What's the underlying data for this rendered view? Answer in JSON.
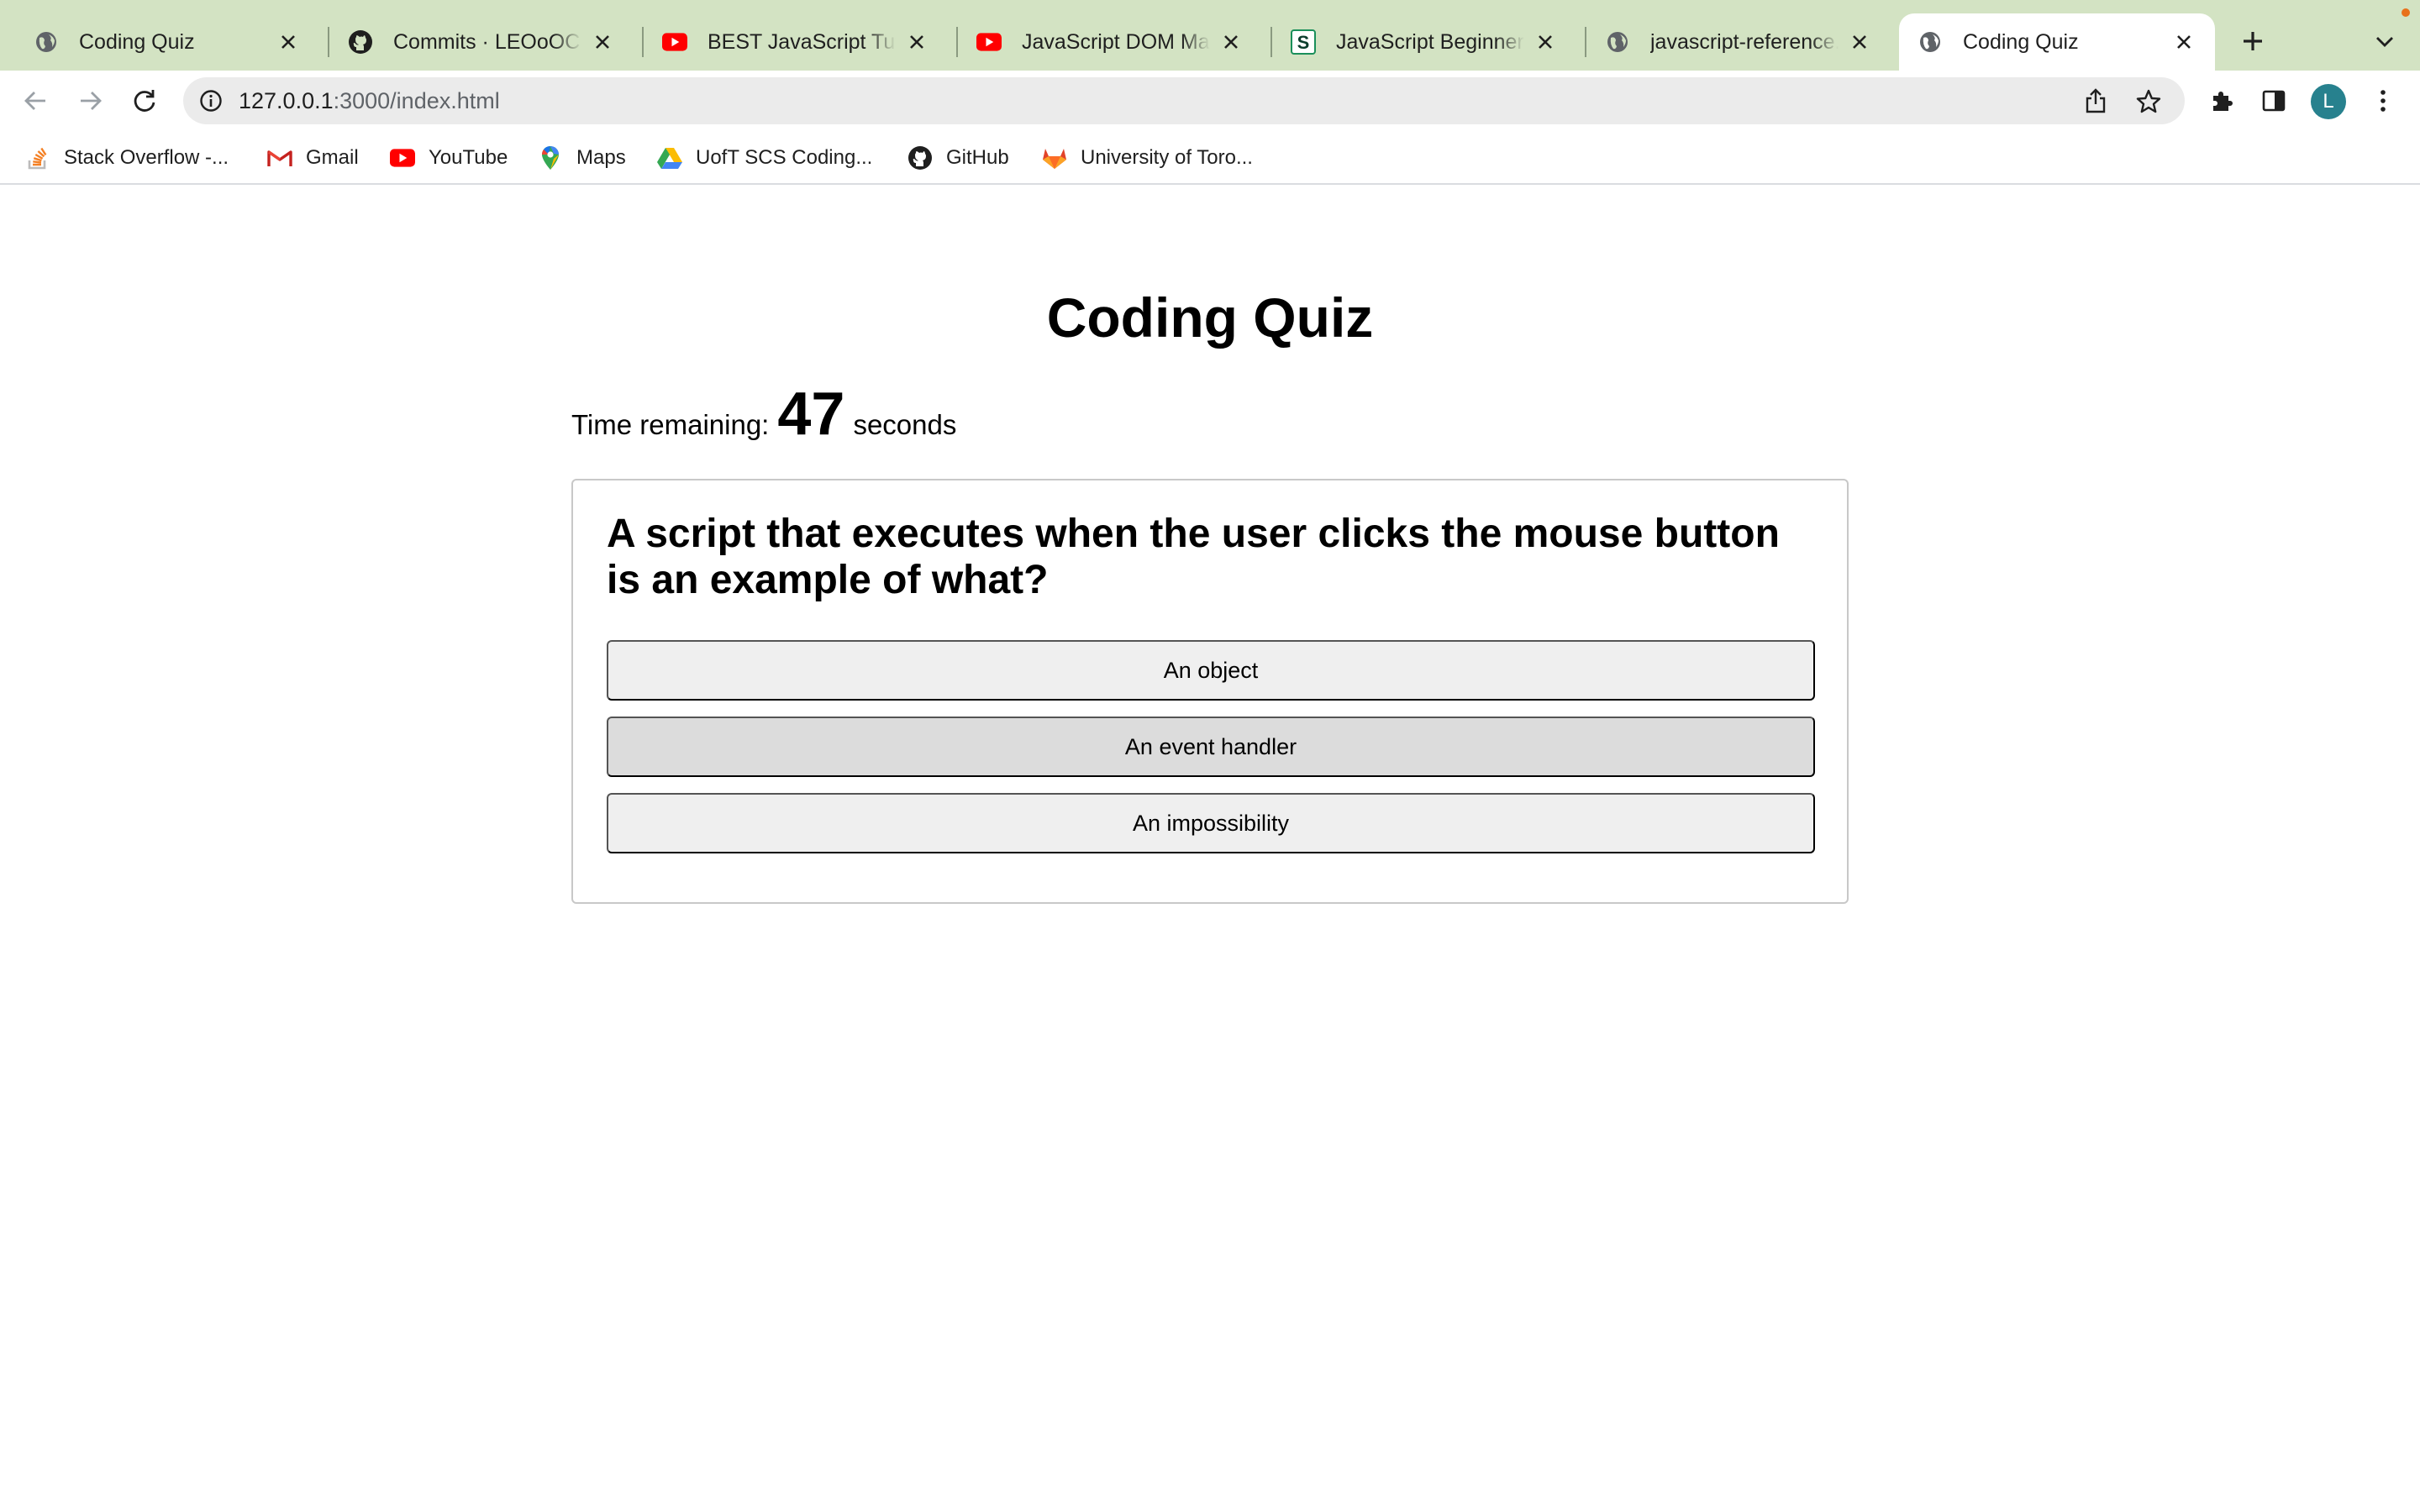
{
  "browser": {
    "tabs": [
      {
        "title": "Coding Quiz",
        "icon": "globe-icon",
        "active": false
      },
      {
        "title": "Commits · LEOoOChan",
        "icon": "github-icon",
        "active": false
      },
      {
        "title": "BEST JavaScript Tutorial",
        "icon": "youtube-icon",
        "active": false
      },
      {
        "title": "JavaScript DOM Manipulation",
        "icon": "youtube-icon",
        "active": false
      },
      {
        "title": "JavaScript Beginner Cheatsheet",
        "icon": "s-logo-icon",
        "active": false
      },
      {
        "title": "javascript-reference.pdf",
        "icon": "globe-icon",
        "active": false
      },
      {
        "title": "Coding Quiz",
        "icon": "globe-icon",
        "active": true
      }
    ],
    "address_bar": {
      "host": "127.0.0.1",
      "path": ":3000/index.html"
    },
    "profile_initial": "L",
    "bookmarks": [
      {
        "label": "Stack Overflow -...",
        "icon": "stackoverflow-icon"
      },
      {
        "label": "Gmail",
        "icon": "gmail-icon"
      },
      {
        "label": "YouTube",
        "icon": "youtube-icon"
      },
      {
        "label": "Maps",
        "icon": "maps-pin-icon"
      },
      {
        "label": "UofT SCS Coding...",
        "icon": "google-drive-icon"
      },
      {
        "label": "GitHub",
        "icon": "github-icon"
      },
      {
        "label": "University of Toro...",
        "icon": "gitlab-icon"
      }
    ],
    "colors": {
      "tabstrip": "#d3e3c3",
      "youtube_red": "#ff0000",
      "avatar": "#27818e"
    }
  },
  "page": {
    "title": "Coding Quiz",
    "timer": {
      "label": "Time remaining:",
      "value": "47",
      "unit": "seconds"
    },
    "question": "A script that executes when the user clicks the mouse button is an example of what?",
    "answers": [
      {
        "label": "An object",
        "hovered": false
      },
      {
        "label": "An event handler",
        "hovered": true
      },
      {
        "label": "An impossibility",
        "hovered": false
      }
    ]
  }
}
